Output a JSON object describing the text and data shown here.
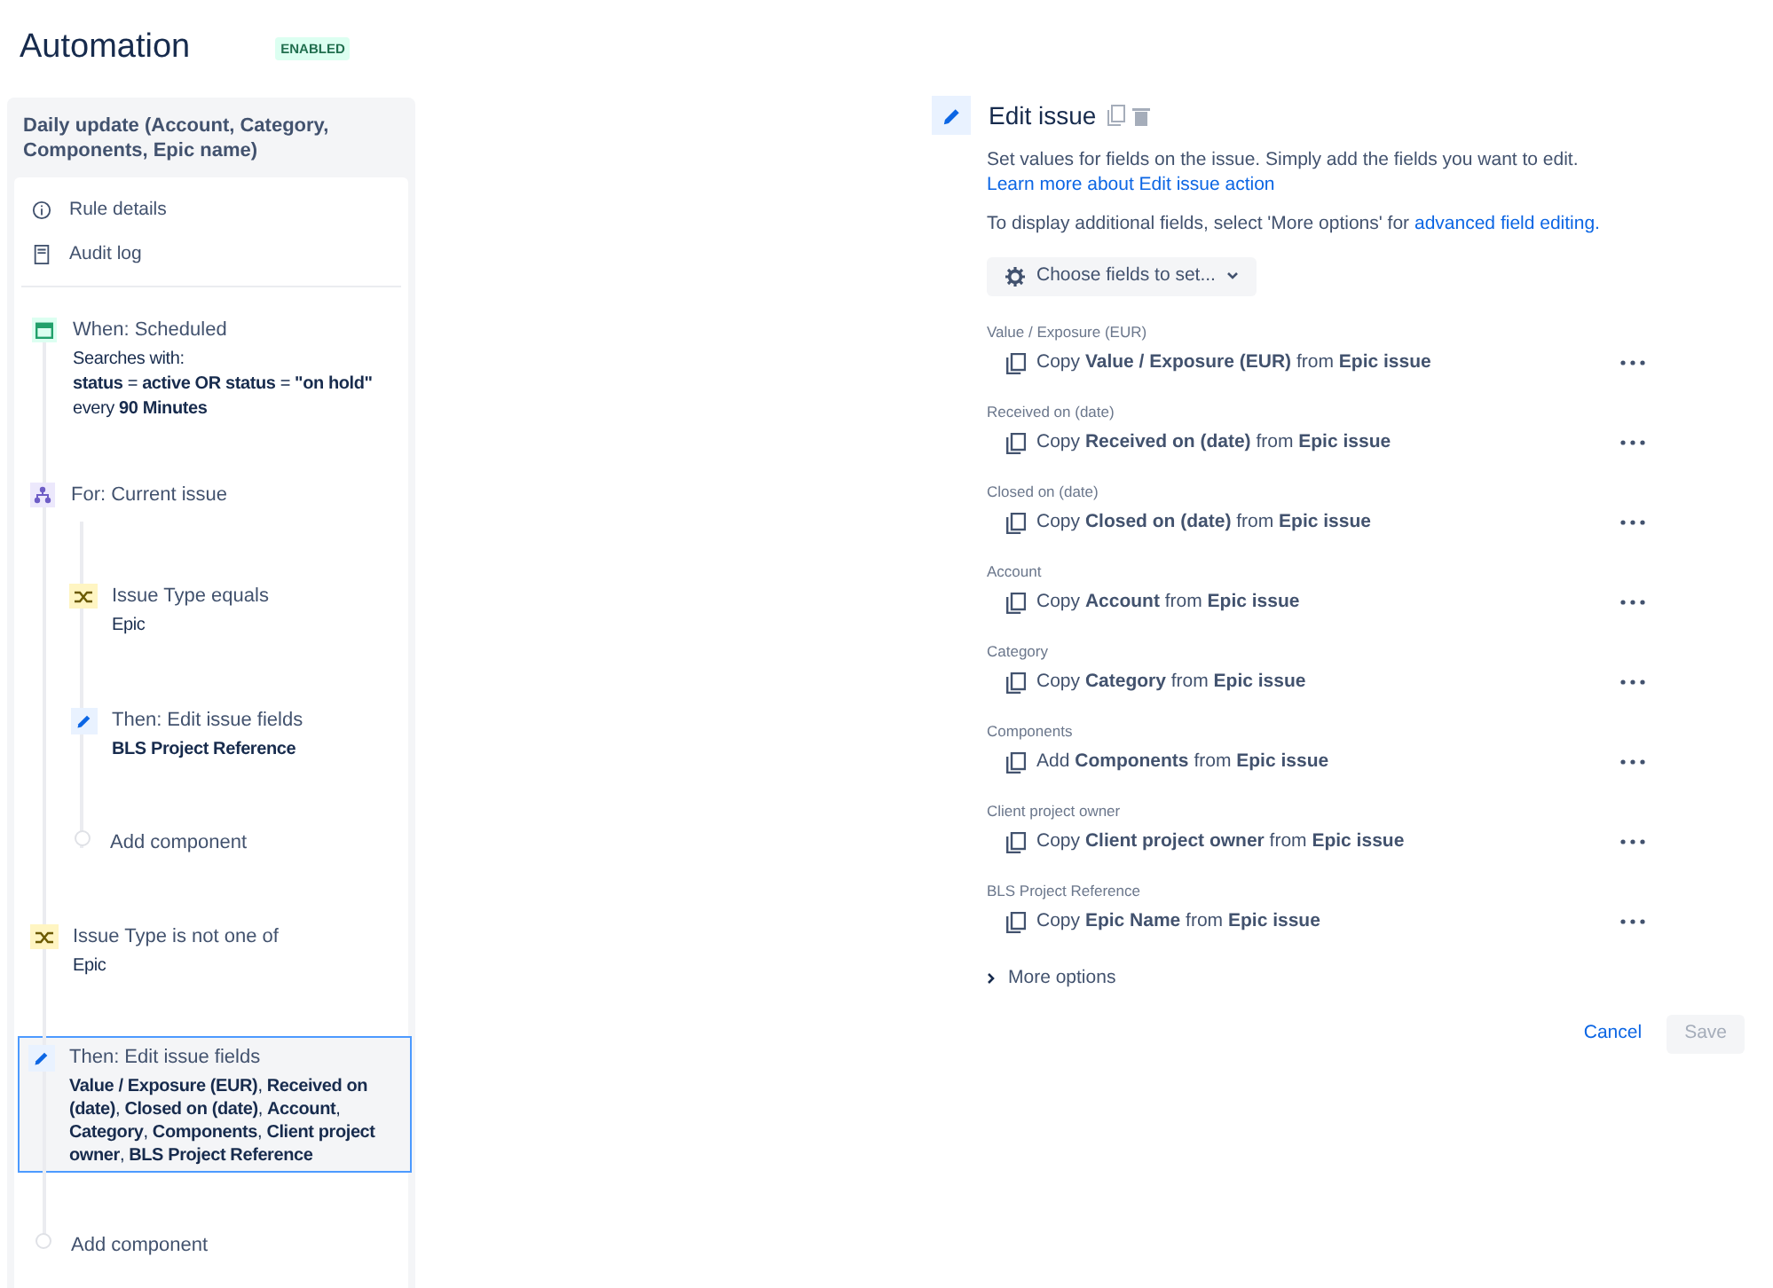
{
  "header": {
    "title": "Automation",
    "status": "ENABLED"
  },
  "rule": {
    "title": "Daily update (Account, Category, Components, Epic name)",
    "nav": [
      {
        "kind": "info",
        "label": "Rule details"
      },
      {
        "kind": "log",
        "label": "Audit log"
      }
    ],
    "flow": [
      {
        "kind": "trigger",
        "title": "When: Scheduled",
        "selected": false,
        "lines": [
          "Searches with:",
          "**status** = **active OR status** = **\"on hold\"**",
          "every **90 Minutes**"
        ]
      },
      {
        "kind": "branch",
        "title": "For: Current issue",
        "children": [
          {
            "kind": "condition",
            "title": "Issue Type equals",
            "selected": false,
            "lines": [
              "Epic"
            ]
          },
          {
            "kind": "action",
            "title": "Then: Edit issue fields",
            "selected": false,
            "lines": [
              "**BLS Project Reference**"
            ]
          },
          {
            "kind": "add",
            "title": "Add component"
          }
        ]
      },
      {
        "kind": "condition",
        "title": "Issue Type is not one of",
        "selected": false,
        "lines": [
          "Epic"
        ]
      },
      {
        "kind": "action",
        "title": "Then: Edit issue fields",
        "selected": true,
        "lines": [
          "**Value / Exposure (EUR)**, **Received on (date)**, **Closed on (date)**, **Account**, **Category**, **Components**, **Client project owner**, **BLS Project Reference**"
        ]
      },
      {
        "kind": "add",
        "title": "Add component"
      }
    ]
  },
  "editor": {
    "title": "Edit issue",
    "description": "Set values for fields on the issue. Simply add the fields you want to edit.",
    "description_link": "Learn more about Edit issue action",
    "hint": "To display additional fields, select 'More options' for",
    "hint_link": "advanced field editing.",
    "choose_button": "Choose fields to set...",
    "fields": [
      {
        "label": "Value / Exposure (EUR)",
        "operation": "Copy **Value / Exposure (EUR)** from **Epic issue**"
      },
      {
        "label": "Received on (date)",
        "operation": "Copy **Received on (date)** from **Epic issue**"
      },
      {
        "label": "Closed on (date)",
        "operation": "Copy **Closed on (date)** from **Epic issue**"
      },
      {
        "label": "Account",
        "operation": "Copy **Account** from **Epic issue**"
      },
      {
        "label": "Category",
        "operation": "Copy **Category** from **Epic issue**"
      },
      {
        "label": "Components",
        "operation": "Add **Components** from **Epic issue**"
      },
      {
        "label": "Client project owner",
        "operation": "Copy **Client project owner** from **Epic issue**"
      },
      {
        "label": "BLS Project Reference",
        "operation": "Copy **Epic Name** from **Epic issue**"
      }
    ],
    "more_options": {
      "label": "More options",
      "expanded": false
    },
    "cancel": "Cancel",
    "save": {
      "label": "Save",
      "disabled": true
    }
  }
}
